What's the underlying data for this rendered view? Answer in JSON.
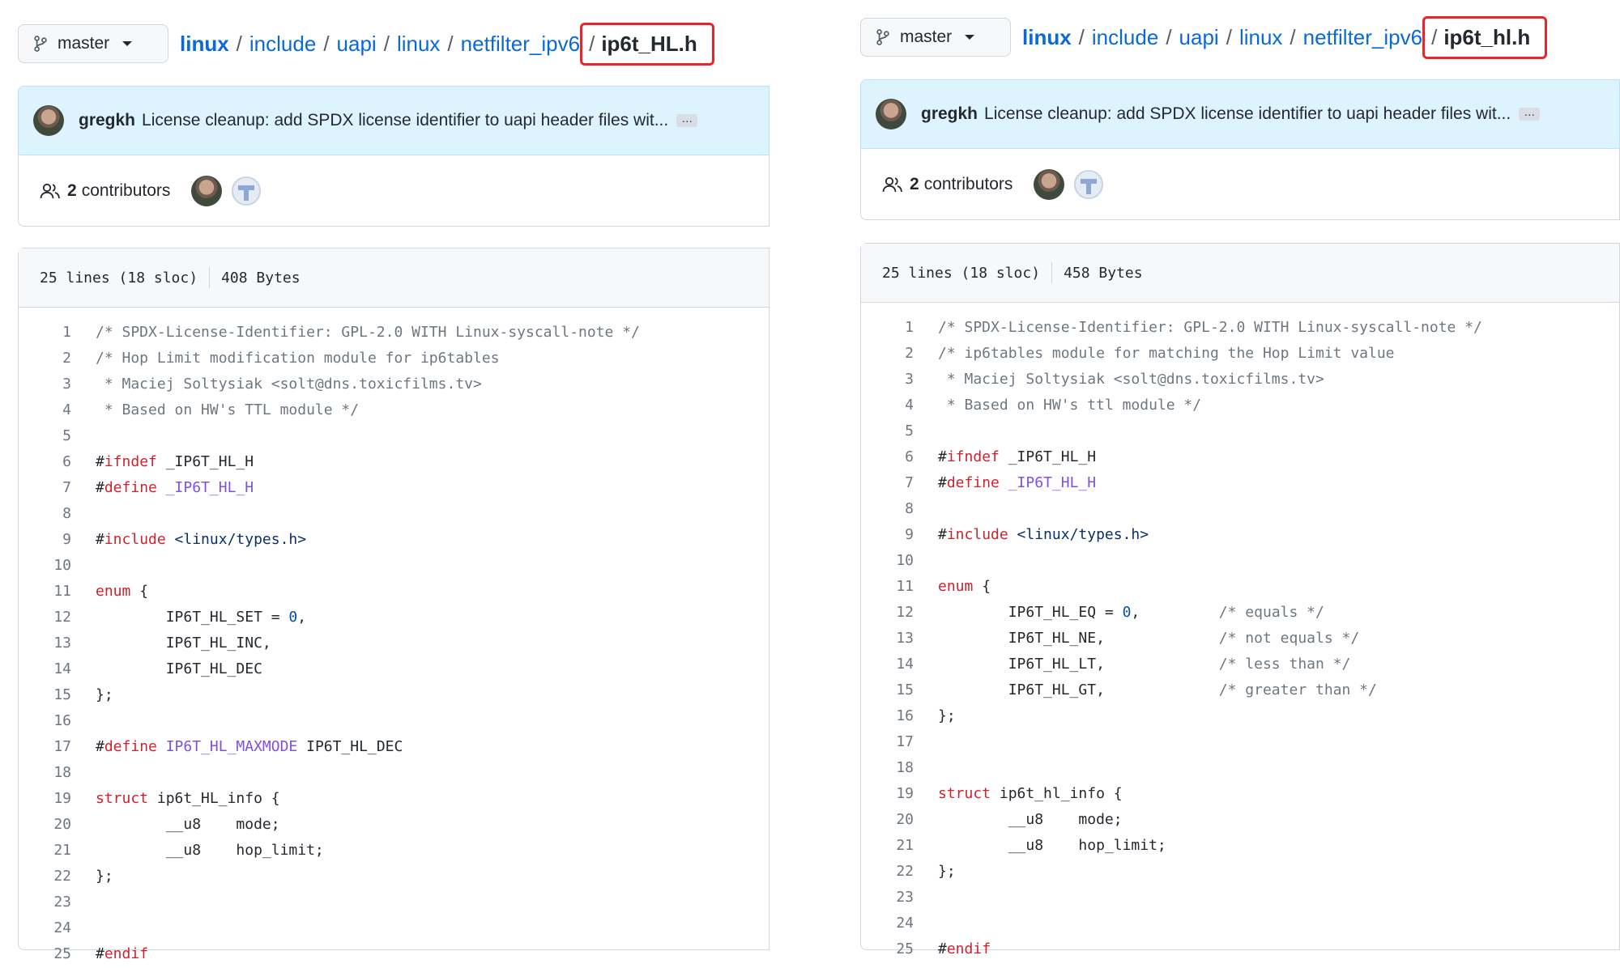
{
  "panels": [
    {
      "branch": "master",
      "breadcrumb": {
        "root": "linux",
        "segments": [
          "include",
          "uapi",
          "linux",
          "netfilter_ipv6"
        ],
        "file": "ip6t_HL.h"
      },
      "commit": {
        "author": "gregkh",
        "message": "License cleanup: add SPDX license identifier to uapi header files wit...",
        "more": "…"
      },
      "contributors": {
        "count": "2",
        "label": "contributors"
      },
      "file_info": {
        "lines": "25 lines (18 sloc)",
        "size": "408 Bytes"
      },
      "code": [
        {
          "n": "1",
          "t": [
            [
              "c",
              "/* SPDX-License-Identifier: GPL-2.0 WITH Linux-syscall-note */"
            ]
          ]
        },
        {
          "n": "2",
          "t": [
            [
              "c",
              "/* Hop Limit modification module for ip6tables"
            ]
          ]
        },
        {
          "n": "3",
          "t": [
            [
              "c",
              " * Maciej Soltysiak <solt@dns.toxicfilms.tv>"
            ]
          ]
        },
        {
          "n": "4",
          "t": [
            [
              "c",
              " * Based on HW's TTL module */"
            ]
          ]
        },
        {
          "n": "5",
          "t": []
        },
        {
          "n": "6",
          "t": [
            [
              "",
              "#"
            ],
            [
              "k",
              "ifndef"
            ],
            [
              "",
              " _IP6T_HL_H"
            ]
          ]
        },
        {
          "n": "7",
          "t": [
            [
              "",
              "#"
            ],
            [
              "k",
              "define"
            ],
            [
              "",
              " "
            ],
            [
              "p",
              "_IP6T_HL_H"
            ]
          ]
        },
        {
          "n": "8",
          "t": []
        },
        {
          "n": "9",
          "t": [
            [
              "",
              "#"
            ],
            [
              "k",
              "include"
            ],
            [
              "",
              " "
            ],
            [
              "s",
              "<linux/types.h>"
            ]
          ]
        },
        {
          "n": "10",
          "t": []
        },
        {
          "n": "11",
          "t": [
            [
              "k",
              "enum"
            ],
            [
              "",
              " {"
            ]
          ]
        },
        {
          "n": "12",
          "t": [
            [
              "",
              "        IP6T_HL_SET = "
            ],
            [
              "n",
              "0"
            ],
            [
              "",
              ","
            ]
          ]
        },
        {
          "n": "13",
          "t": [
            [
              "",
              "        IP6T_HL_INC,"
            ]
          ]
        },
        {
          "n": "14",
          "t": [
            [
              "",
              "        IP6T_HL_DEC"
            ]
          ]
        },
        {
          "n": "15",
          "t": [
            [
              "",
              "};"
            ]
          ]
        },
        {
          "n": "16",
          "t": []
        },
        {
          "n": "17",
          "t": [
            [
              "",
              "#"
            ],
            [
              "k",
              "define"
            ],
            [
              "",
              " "
            ],
            [
              "p",
              "IP6T_HL_MAXMODE"
            ],
            [
              "",
              " IP6T_HL_DEC"
            ]
          ]
        },
        {
          "n": "18",
          "t": []
        },
        {
          "n": "19",
          "t": [
            [
              "k",
              "struct"
            ],
            [
              "",
              " ip6t_HL_info {"
            ]
          ]
        },
        {
          "n": "20",
          "t": [
            [
              "",
              "        __u8    mode;"
            ]
          ]
        },
        {
          "n": "21",
          "t": [
            [
              "",
              "        __u8    hop_limit;"
            ]
          ]
        },
        {
          "n": "22",
          "t": [
            [
              "",
              "};"
            ]
          ]
        },
        {
          "n": "23",
          "t": []
        },
        {
          "n": "24",
          "t": []
        },
        {
          "n": "25",
          "t": [
            [
              "",
              "#"
            ],
            [
              "k",
              "endif"
            ]
          ]
        }
      ]
    },
    {
      "branch": "master",
      "breadcrumb": {
        "root": "linux",
        "segments": [
          "include",
          "uapi",
          "linux",
          "netfilter_ipv6"
        ],
        "file": "ip6t_hl.h"
      },
      "commit": {
        "author": "gregkh",
        "message": "License cleanup: add SPDX license identifier to uapi header files wit...",
        "more": "…"
      },
      "contributors": {
        "count": "2",
        "label": "contributors"
      },
      "file_info": {
        "lines": "25 lines (18 sloc)",
        "size": "458 Bytes"
      },
      "code": [
        {
          "n": "1",
          "t": [
            [
              "c",
              "/* SPDX-License-Identifier: GPL-2.0 WITH Linux-syscall-note */"
            ]
          ]
        },
        {
          "n": "2",
          "t": [
            [
              "c",
              "/* ip6tables module for matching the Hop Limit value"
            ]
          ]
        },
        {
          "n": "3",
          "t": [
            [
              "c",
              " * Maciej Soltysiak <solt@dns.toxicfilms.tv>"
            ]
          ]
        },
        {
          "n": "4",
          "t": [
            [
              "c",
              " * Based on HW's ttl module */"
            ]
          ]
        },
        {
          "n": "5",
          "t": []
        },
        {
          "n": "6",
          "t": [
            [
              "",
              "#"
            ],
            [
              "k",
              "ifndef"
            ],
            [
              "",
              " _IP6T_HL_H"
            ]
          ]
        },
        {
          "n": "7",
          "t": [
            [
              "",
              "#"
            ],
            [
              "k",
              "define"
            ],
            [
              "",
              " "
            ],
            [
              "p",
              "_IP6T_HL_H"
            ]
          ]
        },
        {
          "n": "8",
          "t": []
        },
        {
          "n": "9",
          "t": [
            [
              "",
              "#"
            ],
            [
              "k",
              "include"
            ],
            [
              "",
              " "
            ],
            [
              "s",
              "<linux/types.h>"
            ]
          ]
        },
        {
          "n": "10",
          "t": []
        },
        {
          "n": "11",
          "t": [
            [
              "k",
              "enum"
            ],
            [
              "",
              " {"
            ]
          ]
        },
        {
          "n": "12",
          "t": [
            [
              "",
              "        IP6T_HL_EQ = "
            ],
            [
              "n",
              "0"
            ],
            [
              "",
              ",         "
            ],
            [
              "c",
              "/* equals */"
            ]
          ]
        },
        {
          "n": "13",
          "t": [
            [
              "",
              "        IP6T_HL_NE,             "
            ],
            [
              "c",
              "/* not equals */"
            ]
          ]
        },
        {
          "n": "14",
          "t": [
            [
              "",
              "        IP6T_HL_LT,             "
            ],
            [
              "c",
              "/* less than */"
            ]
          ]
        },
        {
          "n": "15",
          "t": [
            [
              "",
              "        IP6T_HL_GT,             "
            ],
            [
              "c",
              "/* greater than */"
            ]
          ]
        },
        {
          "n": "16",
          "t": [
            [
              "",
              "};"
            ]
          ]
        },
        {
          "n": "17",
          "t": []
        },
        {
          "n": "18",
          "t": []
        },
        {
          "n": "19",
          "t": [
            [
              "k",
              "struct"
            ],
            [
              "",
              " ip6t_hl_info {"
            ]
          ]
        },
        {
          "n": "20",
          "t": [
            [
              "",
              "        __u8    mode;"
            ]
          ]
        },
        {
          "n": "21",
          "t": [
            [
              "",
              "        __u8    hop_limit;"
            ]
          ]
        },
        {
          "n": "22",
          "t": [
            [
              "",
              "};"
            ]
          ]
        },
        {
          "n": "23",
          "t": []
        },
        {
          "n": "24",
          "t": []
        },
        {
          "n": "25",
          "t": [
            [
              "",
              "#"
            ],
            [
              "k",
              "endif"
            ]
          ]
        }
      ]
    }
  ]
}
